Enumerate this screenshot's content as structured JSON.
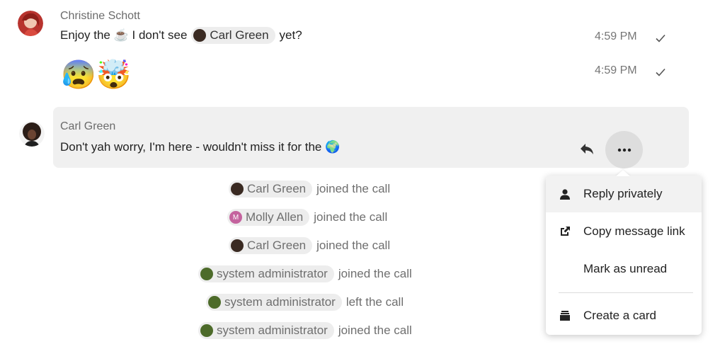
{
  "messages": [
    {
      "author": "Christine Schott",
      "text_before": "Enjoy the ☕ I don't see",
      "mention": "Carl Green",
      "text_after": "yet?",
      "time": "4:59 PM"
    },
    {
      "emojis": "😰🤯",
      "time": "4:59 PM"
    },
    {
      "author": "Carl Green",
      "text": "Don't yah worry, I'm here - wouldn't miss it for the 🌍"
    }
  ],
  "system_messages": [
    {
      "user": "Carl Green",
      "action": "joined the call"
    },
    {
      "user": "Molly Allen",
      "avatar_letter": "M",
      "action": "joined the call"
    },
    {
      "user": "Carl Green",
      "action": "joined the call"
    },
    {
      "user": "system administrator",
      "action": "joined the call"
    },
    {
      "user": "system administrator",
      "action": "left the call"
    },
    {
      "user": "system administrator",
      "action": "joined the call"
    }
  ],
  "menu": {
    "items": [
      {
        "label": "Reply privately",
        "icon": "user-icon"
      },
      {
        "label": "Copy message link",
        "icon": "external-link-icon"
      },
      {
        "label": "Mark as unread",
        "icon": ""
      },
      {
        "label": "Create a card",
        "icon": "deck-card-icon"
      }
    ]
  },
  "colors": {
    "molly_avatar": "#c4639e",
    "hover_bg": "#f0f0f0",
    "chip_bg": "#ededed"
  }
}
